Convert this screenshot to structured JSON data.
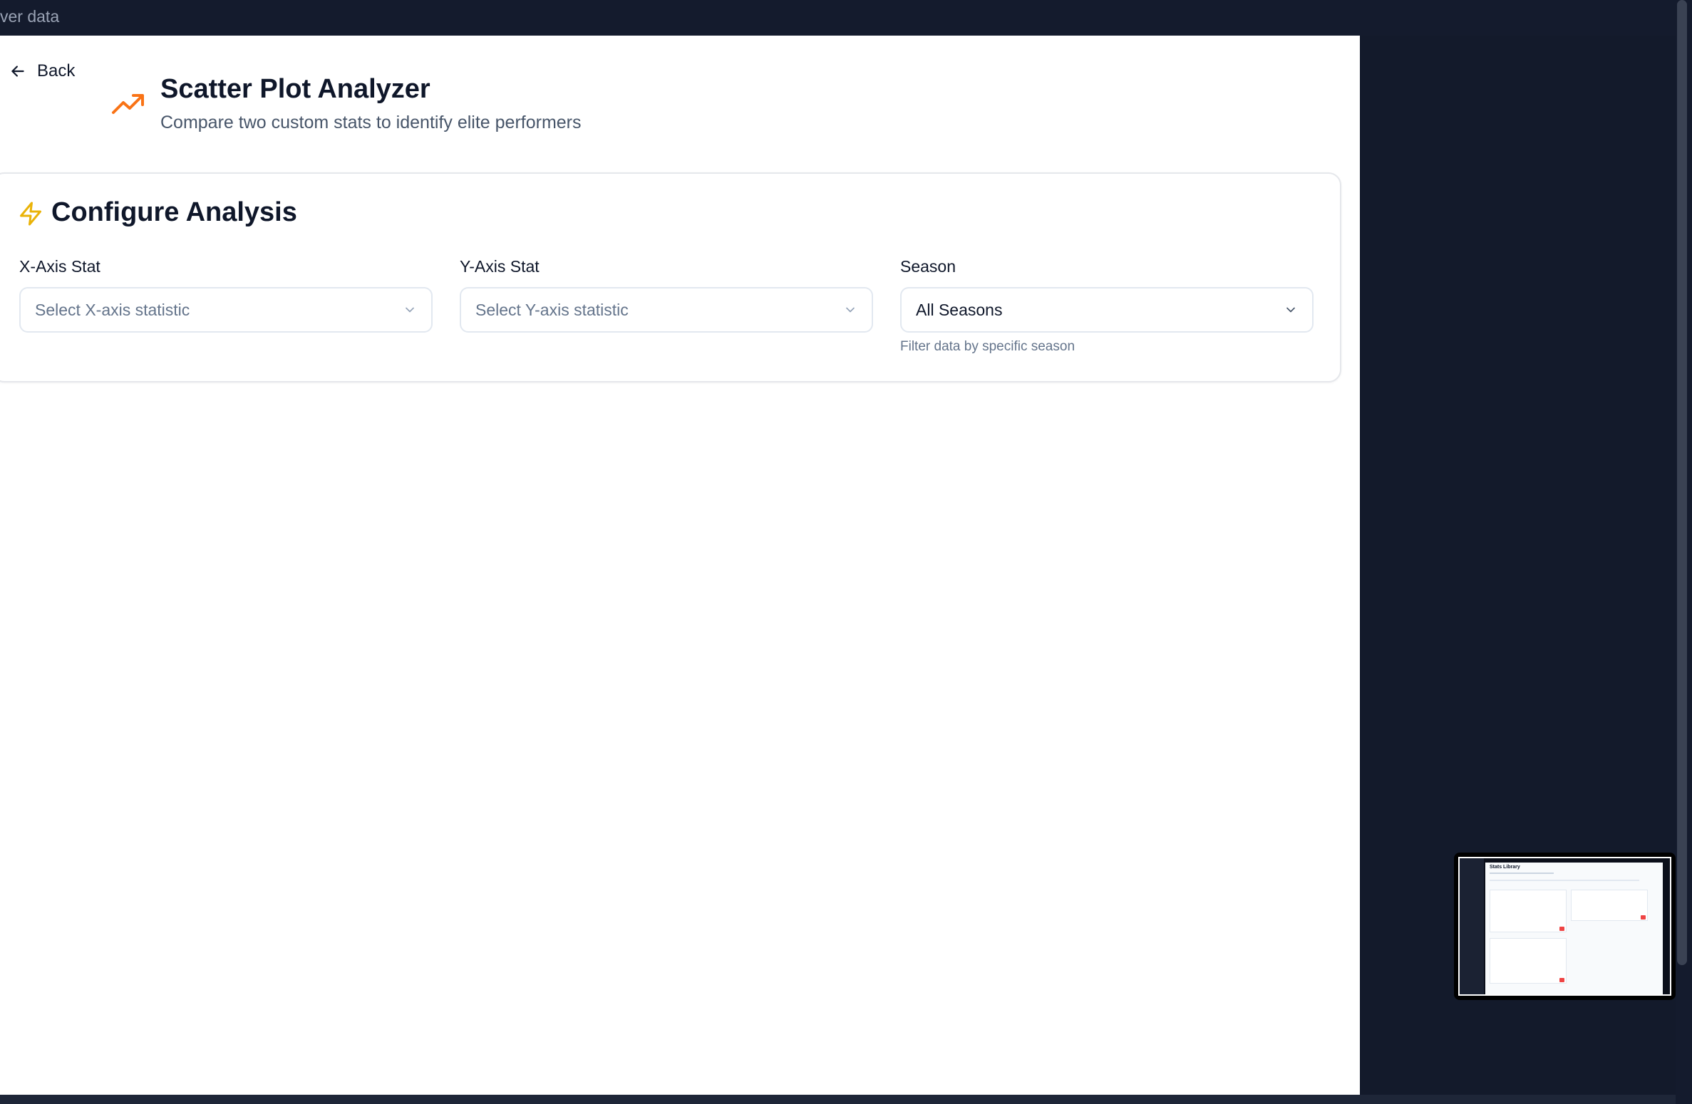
{
  "topbar": {
    "text": "ver data"
  },
  "header": {
    "back_label": "Back",
    "title": "Scatter Plot Analyzer",
    "subtitle": "Compare two custom stats to identify elite performers",
    "icon": "trending-up-icon",
    "icon_color": "#f97316"
  },
  "config": {
    "title": "Configure Analysis",
    "icon": "lightning-icon",
    "icon_color": "#eab308",
    "x_axis": {
      "label": "X-Axis Stat",
      "placeholder": "Select X-axis statistic"
    },
    "y_axis": {
      "label": "Y-Axis Stat",
      "placeholder": "Select Y-axis statistic"
    },
    "season": {
      "label": "Season",
      "value": "All Seasons",
      "help": "Filter data by specific season"
    }
  },
  "thumbnail": {
    "title": "Stats Library"
  }
}
